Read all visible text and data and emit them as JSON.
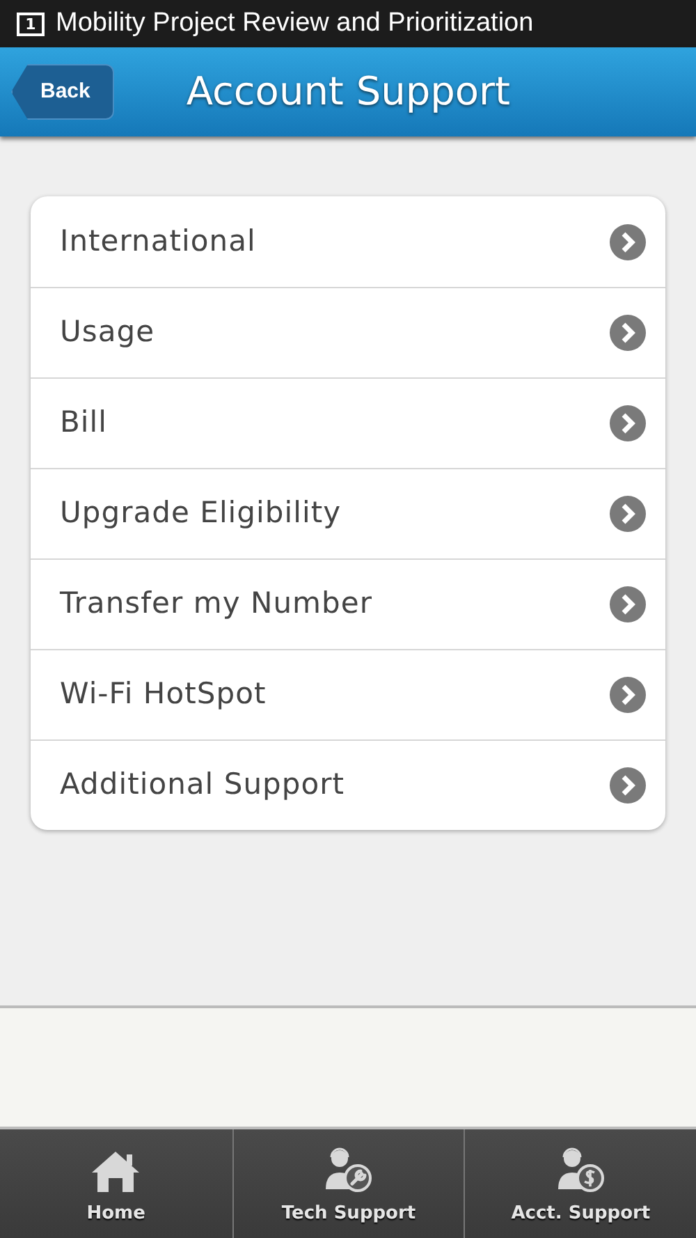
{
  "status_bar": {
    "badge": "1",
    "title": "Mobility Project Review and Prioritization"
  },
  "header": {
    "back": "Back",
    "title": "Account Support"
  },
  "menu": [
    {
      "label": "International"
    },
    {
      "label": "Usage"
    },
    {
      "label": "Bill"
    },
    {
      "label": "Upgrade Eligibility"
    },
    {
      "label": "Transfer my Number"
    },
    {
      "label": "Wi-Fi HotSpot"
    },
    {
      "label": "Additional Support"
    }
  ],
  "tab_bar": [
    {
      "kind": "home",
      "label": "Home"
    },
    {
      "kind": "tech",
      "label": "Tech Support"
    },
    {
      "kind": "account",
      "label": "Acct. Support"
    }
  ]
}
